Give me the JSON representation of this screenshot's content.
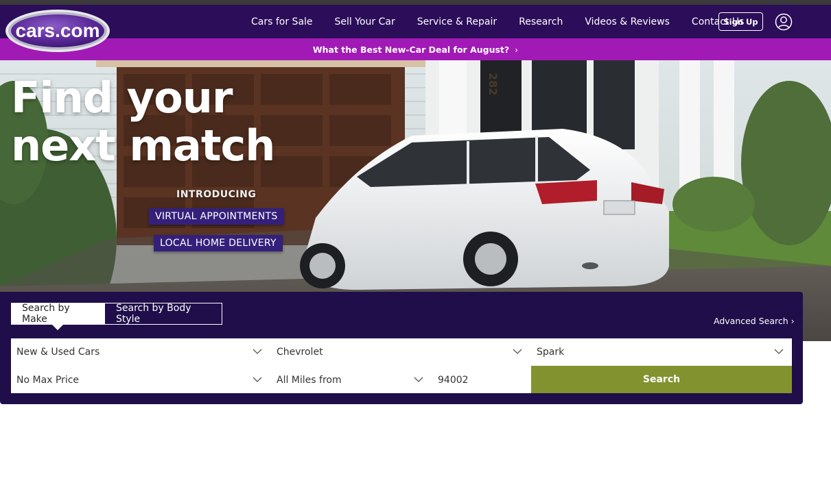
{
  "brand": {
    "logo_text": "cars.com"
  },
  "nav": {
    "items": [
      "Cars for Sale",
      "Sell Your Car",
      "Service & Repair",
      "Research",
      "Videos & Reviews",
      "Contact Us"
    ],
    "signup_label": "Sign Up",
    "account_icon": "user-circle-icon"
  },
  "promo": {
    "text": "What the Best New-Car Deal for August?",
    "chevron": "›"
  },
  "hero": {
    "headline_line1": "Find your",
    "headline_line2": "next match",
    "introducing": "INTRODUCING",
    "tags": [
      "VIRTUAL APPOINTMENTS",
      "LOCAL HOME DELIVERY"
    ],
    "house_number": "282"
  },
  "search": {
    "tabs": [
      "Search by Make",
      "Search by Body Style"
    ],
    "active_tab": "Search by Make",
    "advanced_label": "Advanced Search",
    "advanced_chevron": "›",
    "stock_type": "New & Used Cars",
    "make": "Chevrolet",
    "model": "Spark",
    "max_price": "No Max Price",
    "distance": "All Miles from",
    "zip": "94002",
    "search_label": "Search"
  },
  "colors": {
    "nav_bg": "#2b0d59",
    "promo_bg": "#a11ab6",
    "panel_bg": "#1f0e4a",
    "search_btn": "#82922f"
  }
}
